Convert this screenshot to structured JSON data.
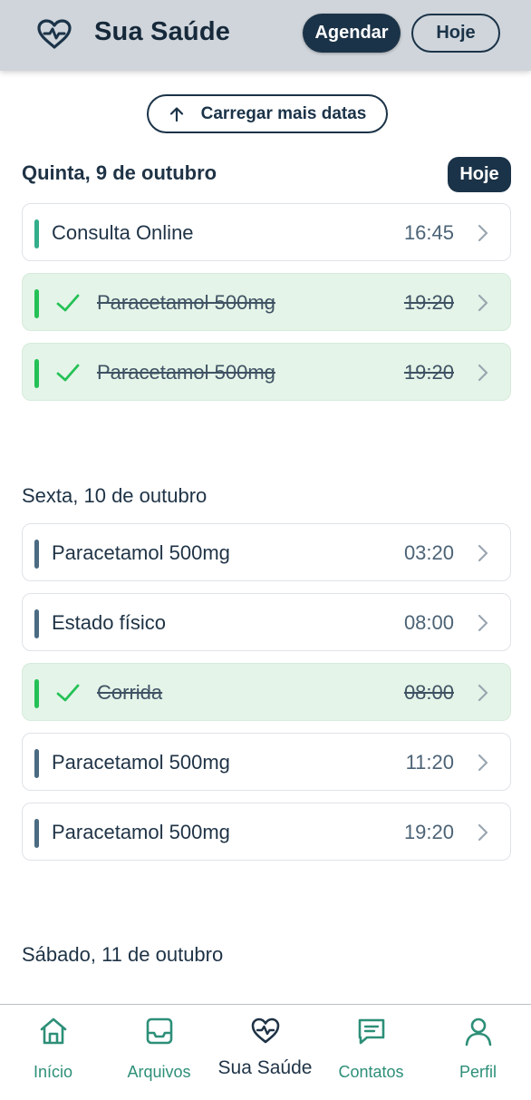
{
  "header": {
    "title": "Sua Saúde",
    "agendar_label": "Agendar",
    "hoje_label": "Hoje"
  },
  "load_more_label": "Carregar mais datas",
  "days": [
    {
      "title": "Quinta, 9 de outubro",
      "badge": "Hoje",
      "items": [
        {
          "title": "Consulta Online",
          "time": "16:45",
          "done": false
        },
        {
          "title": "Paracetamol 500mg",
          "time": "19:20",
          "done": true
        },
        {
          "title": "Paracetamol 500mg",
          "time": "19:20",
          "done": true
        }
      ]
    },
    {
      "title": "Sexta, 10 de outubro",
      "items": [
        {
          "title": "Paracetamol 500mg",
          "time": "03:20",
          "done": false
        },
        {
          "title": "Estado físico",
          "time": "08:00",
          "done": false
        },
        {
          "title": "Corrida",
          "time": "08:00",
          "done": true
        },
        {
          "title": "Paracetamol 500mg",
          "time": "11:20",
          "done": false
        },
        {
          "title": "Paracetamol 500mg",
          "time": "19:20",
          "done": false
        }
      ]
    },
    {
      "title": "Sábado, 11 de outubro",
      "items": []
    }
  ],
  "bottom_nav": [
    {
      "label": "Início",
      "icon": "home-icon"
    },
    {
      "label": "Arquivos",
      "icon": "inbox-icon"
    },
    {
      "label": "Sua Saúde",
      "icon": "heart-pulse-icon",
      "active": true
    },
    {
      "label": "Contatos",
      "icon": "chat-icon"
    },
    {
      "label": "Perfil",
      "icon": "user-icon"
    }
  ],
  "colors": {
    "primary": "#1b3348",
    "accent": "#2d8f78",
    "done_bg": "#e4f4e8",
    "done_bar": "#25c156",
    "pending_bar": "#4b6b82"
  }
}
